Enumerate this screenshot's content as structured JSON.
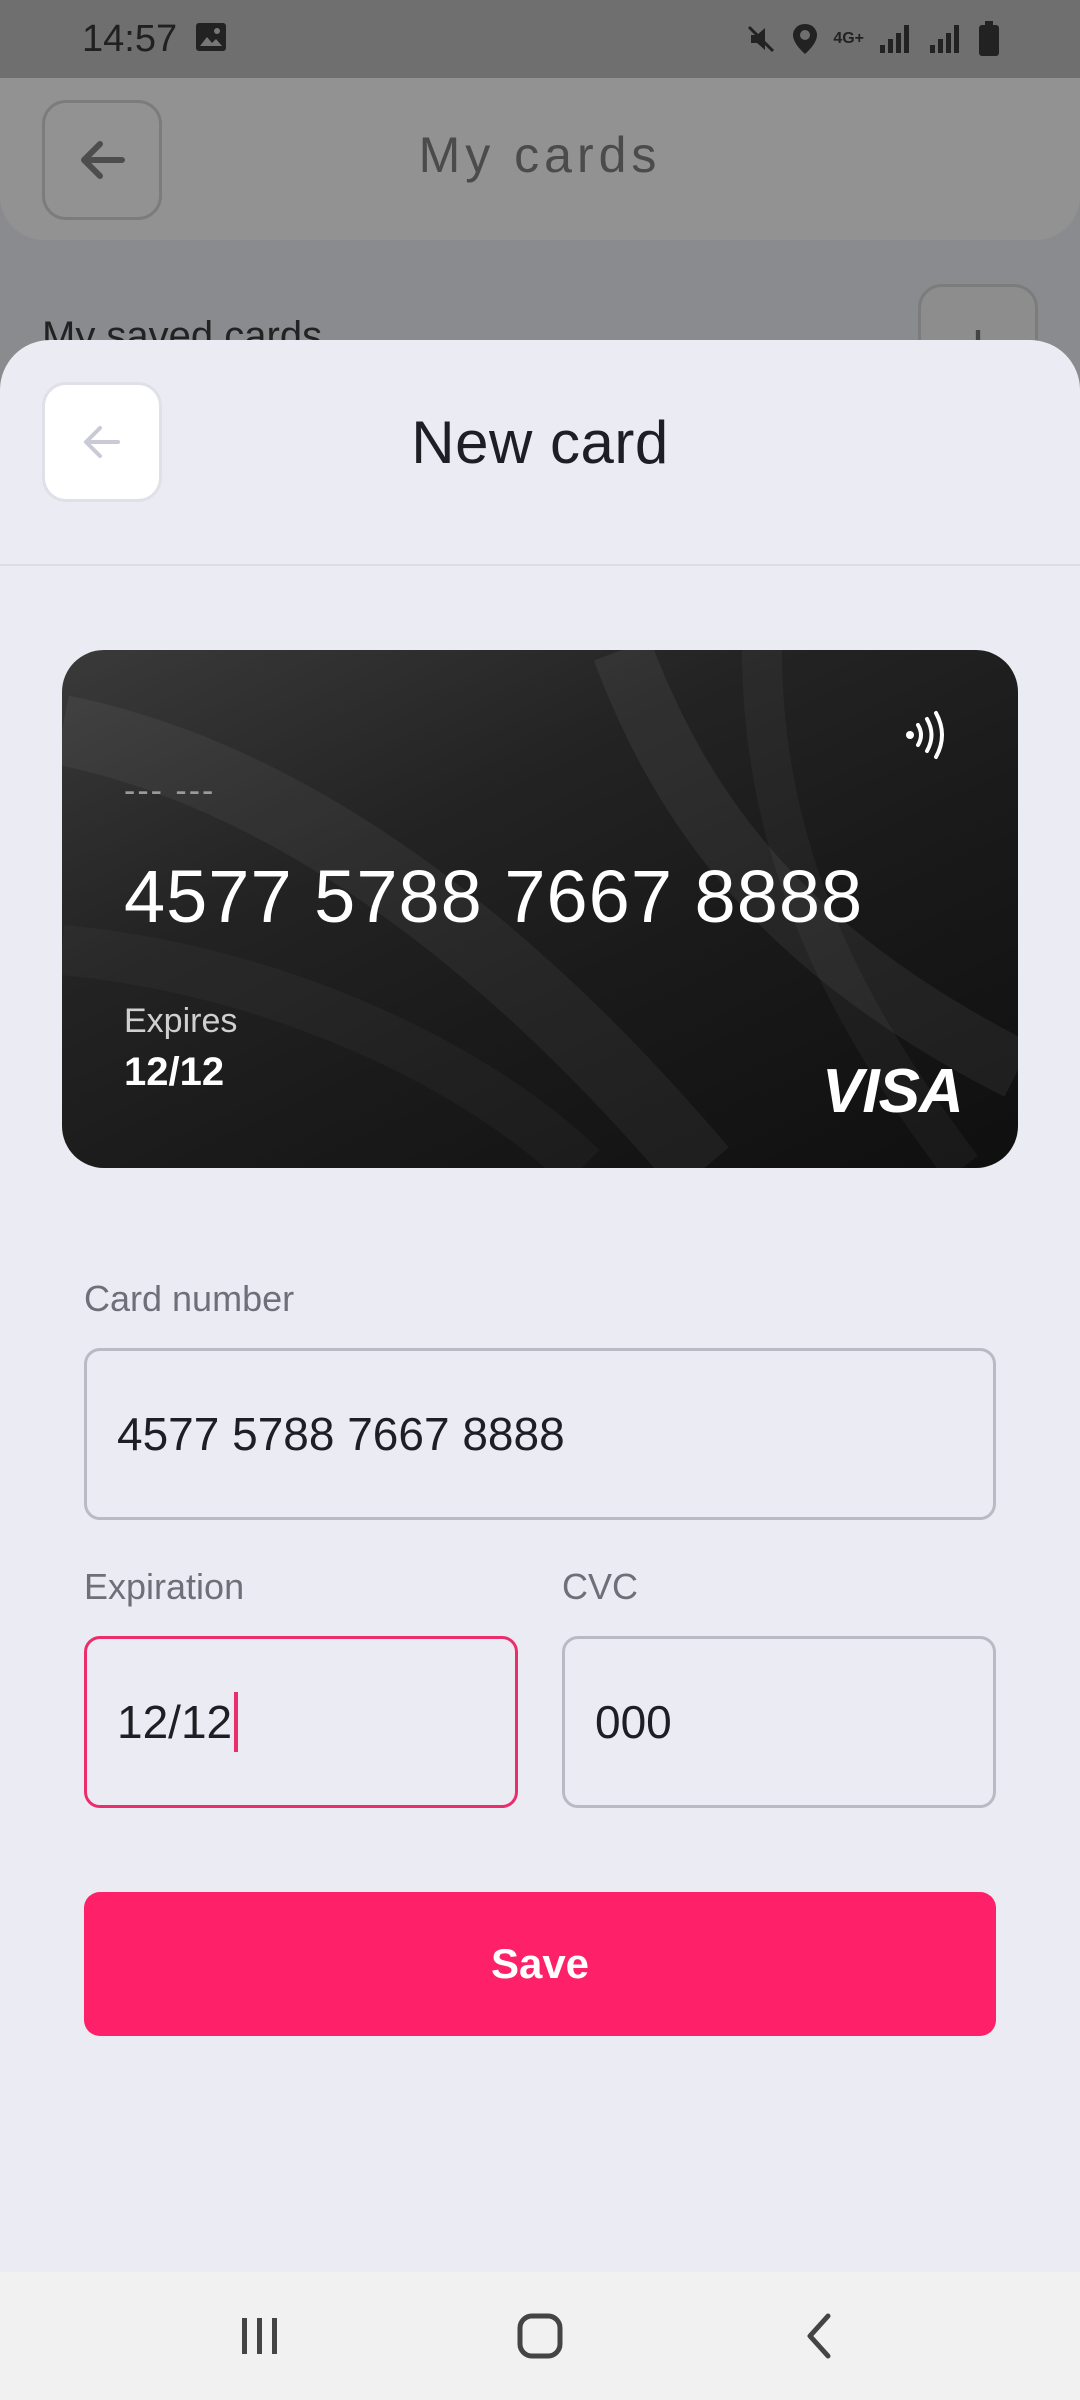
{
  "status_bar": {
    "time": "14:57",
    "network": "4G+",
    "icons": [
      "image-icon",
      "mute-icon",
      "location-icon",
      "signal-icon",
      "battery-icon"
    ]
  },
  "background_page": {
    "title": "My cards",
    "subtitle": "My saved cards",
    "add_label": "+"
  },
  "sheet": {
    "title": "New card",
    "card": {
      "name": "--- ---",
      "number": "4577 5788 7667 8888",
      "expires_label": "Expires",
      "expires_value": "12/12",
      "brand": "VISA"
    },
    "form": {
      "card_number_label": "Card number",
      "card_number_value": "4577 5788 7667 8888",
      "expiration_label": "Expiration",
      "expiration_value": "12/12",
      "cvc_label": "CVC",
      "cvc_value": "000"
    },
    "save_label": "Save"
  },
  "colors": {
    "accent": "#fe2068",
    "focus_border": "#ec2d6b",
    "sheet_bg": "#ebecf3"
  }
}
